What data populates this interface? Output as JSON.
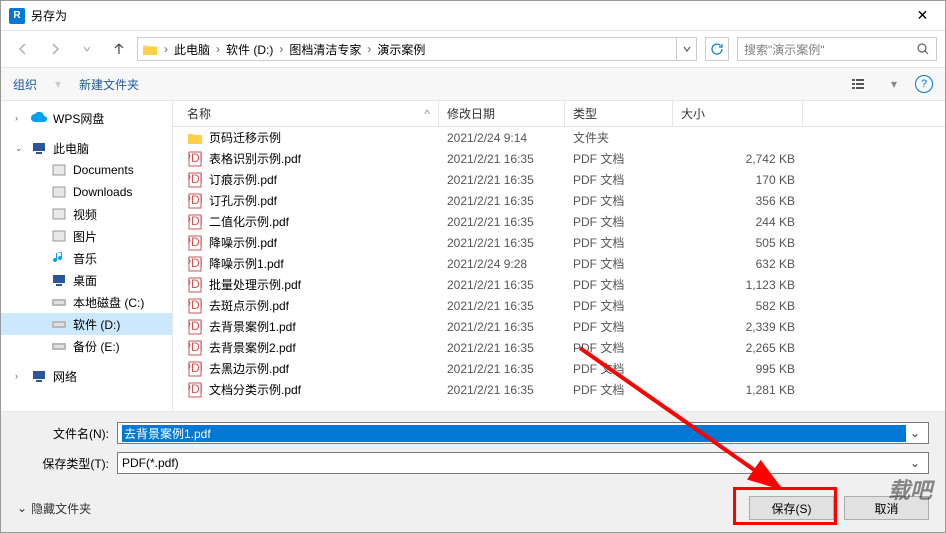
{
  "window": {
    "title": "另存为"
  },
  "breadcrumb": {
    "segments": [
      "此电脑",
      "软件 (D:)",
      "图档清洁专家",
      "演示案例"
    ]
  },
  "search": {
    "placeholder": "搜索\"演示案例\""
  },
  "toolbar": {
    "organize": "组织",
    "new_folder": "新建文件夹"
  },
  "sidebar": {
    "items": [
      {
        "id": "wps",
        "label": "WPS网盘",
        "color": "#00a1f1",
        "indent": 0
      },
      {
        "id": "thispc",
        "label": "此电脑",
        "color": "#2b579a",
        "indent": 0
      },
      {
        "id": "documents",
        "label": "Documents",
        "color": "#888",
        "indent": 1
      },
      {
        "id": "downloads",
        "label": "Downloads",
        "color": "#888",
        "indent": 1
      },
      {
        "id": "video",
        "label": "视频",
        "color": "#555",
        "indent": 1
      },
      {
        "id": "pictures",
        "label": "图片",
        "color": "#555",
        "indent": 1
      },
      {
        "id": "music",
        "label": "音乐",
        "color": "#00a1f1",
        "indent": 1
      },
      {
        "id": "desktop",
        "label": "桌面",
        "color": "#2b579a",
        "indent": 1
      },
      {
        "id": "localc",
        "label": "本地磁盘 (C:)",
        "color": "#888",
        "indent": 1
      },
      {
        "id": "softd",
        "label": "软件 (D:)",
        "color": "#888",
        "indent": 1,
        "selected": true
      },
      {
        "id": "backupe",
        "label": "备份 (E:)",
        "color": "#888",
        "indent": 1
      },
      {
        "id": "network",
        "label": "网络",
        "color": "#2b579a",
        "indent": 0
      }
    ]
  },
  "columns": {
    "name": "名称",
    "date": "修改日期",
    "type": "类型",
    "size": "大小"
  },
  "files": [
    {
      "name": "页码迁移示例",
      "date": "2021/2/24 9:14",
      "type": "文件夹",
      "size": "",
      "is_folder": true
    },
    {
      "name": "表格识别示例.pdf",
      "date": "2021/2/21 16:35",
      "type": "PDF 文档",
      "size": "2,742 KB"
    },
    {
      "name": "订痕示例.pdf",
      "date": "2021/2/21 16:35",
      "type": "PDF 文档",
      "size": "170 KB"
    },
    {
      "name": "订孔示例.pdf",
      "date": "2021/2/21 16:35",
      "type": "PDF 文档",
      "size": "356 KB"
    },
    {
      "name": "二值化示例.pdf",
      "date": "2021/2/21 16:35",
      "type": "PDF 文档",
      "size": "244 KB"
    },
    {
      "name": "降噪示例.pdf",
      "date": "2021/2/21 16:35",
      "type": "PDF 文档",
      "size": "505 KB"
    },
    {
      "name": "降噪示例1.pdf",
      "date": "2021/2/24 9:28",
      "type": "PDF 文档",
      "size": "632 KB"
    },
    {
      "name": "批量处理示例.pdf",
      "date": "2021/2/21 16:35",
      "type": "PDF 文档",
      "size": "1,123 KB"
    },
    {
      "name": "去斑点示例.pdf",
      "date": "2021/2/21 16:35",
      "type": "PDF 文档",
      "size": "582 KB"
    },
    {
      "name": "去背景案例1.pdf",
      "date": "2021/2/21 16:35",
      "type": "PDF 文档",
      "size": "2,339 KB"
    },
    {
      "name": "去背景案例2.pdf",
      "date": "2021/2/21 16:35",
      "type": "PDF 文档",
      "size": "2,265 KB"
    },
    {
      "name": "去黑边示例.pdf",
      "date": "2021/2/21 16:35",
      "type": "PDF 文档",
      "size": "995 KB"
    },
    {
      "name": "文档分类示例.pdf",
      "date": "2021/2/21 16:35",
      "type": "PDF 文档",
      "size": "1,281 KB"
    }
  ],
  "form": {
    "filename_label": "文件名(N):",
    "filename_value": "去背景案例1.pdf",
    "filetype_label": "保存类型(T):",
    "filetype_value": "PDF(*.pdf)"
  },
  "footer": {
    "hide_folders": "隐藏文件夹",
    "save": "保存(S)",
    "cancel": "取消"
  },
  "watermark": "载吧",
  "extra_file_partial": ""
}
